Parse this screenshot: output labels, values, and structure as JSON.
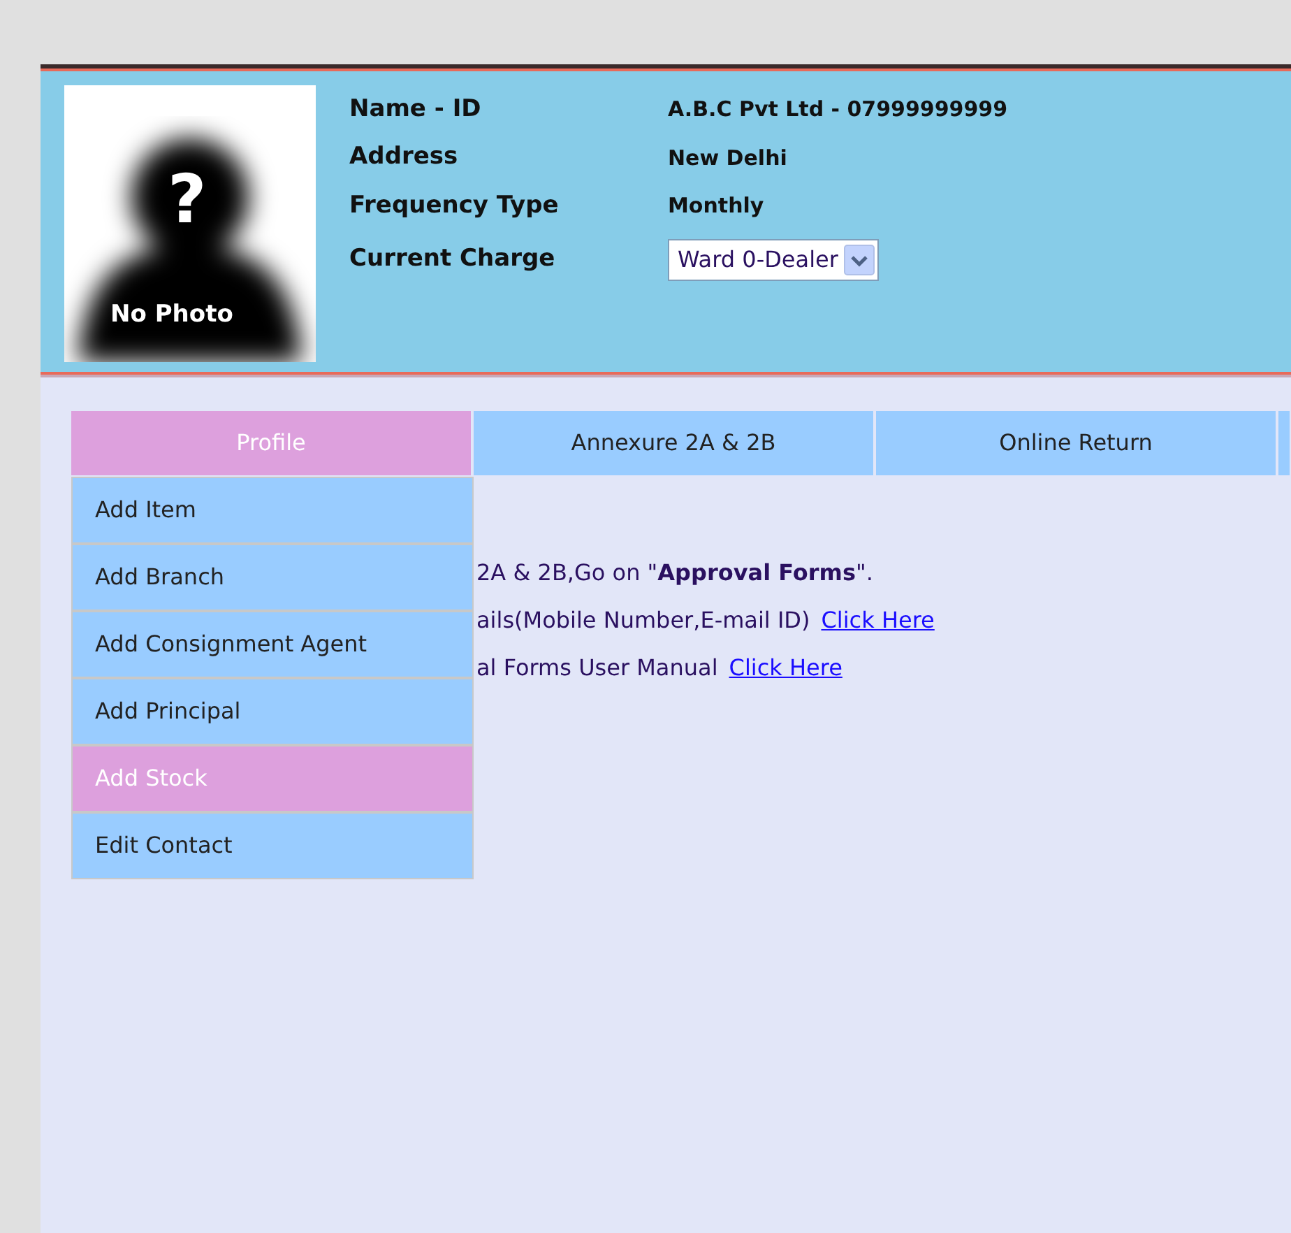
{
  "profile": {
    "photo_mark": "?",
    "photo_caption": "No Photo",
    "fields": [
      {
        "label": "Name - ID",
        "value": "A.B.C Pvt Ltd - 07999999999",
        "kind": "text"
      },
      {
        "label": "Address",
        "value": "New Delhi",
        "kind": "text"
      },
      {
        "label": "Frequency Type",
        "value": "Monthly",
        "kind": "text"
      },
      {
        "label": "Current Charge",
        "value": "Ward 0-Dealer",
        "kind": "select"
      }
    ]
  },
  "tabs": [
    {
      "label": "Profile",
      "selected": true
    },
    {
      "label": "Annexure 2A & 2B",
      "selected": false
    },
    {
      "label": "Online Return",
      "selected": false
    }
  ],
  "menu": [
    {
      "label": "Add Item",
      "selected": false
    },
    {
      "label": "Add Branch",
      "selected": false
    },
    {
      "label": "Add Consignment Agent",
      "selected": false
    },
    {
      "label": "Add Principal",
      "selected": false
    },
    {
      "label": "Add Stock",
      "selected": true
    },
    {
      "label": "Edit Contact",
      "selected": false
    }
  ],
  "notices": [
    {
      "text": "2A & 2B,Go on \"**Approval Forms**\"."
    },
    {
      "text": "ails(Mobile Number,E-mail ID)",
      "link": "Click Here"
    },
    {
      "text": "al Forms User Manual",
      "link": "Click Here"
    }
  ]
}
